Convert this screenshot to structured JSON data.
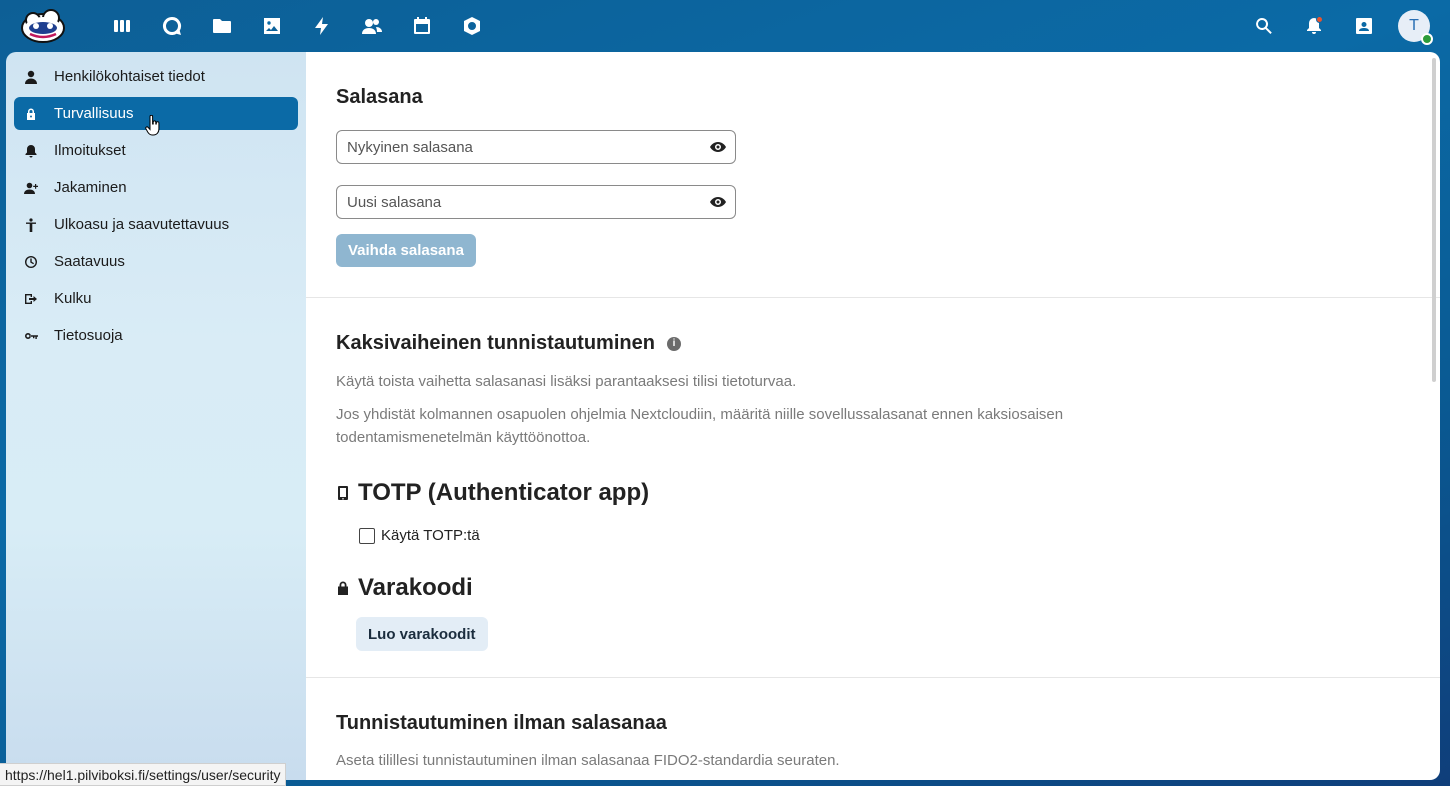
{
  "colors": {
    "accent": "#0b6aa6",
    "disabled_button": "#8fb6d0"
  },
  "header": {
    "apps": [
      "dashboard-icon",
      "search-circle-icon",
      "files-icon",
      "photos-icon",
      "activity-icon",
      "contacts-icon",
      "calendar-icon",
      "settings-box-icon"
    ],
    "avatar_initial": "T"
  },
  "sidebar": {
    "items": [
      {
        "label": "Henkilökohtaiset tiedot",
        "icon": "person-icon"
      },
      {
        "label": "Turvallisuus",
        "icon": "lock-icon",
        "active": true
      },
      {
        "label": "Ilmoitukset",
        "icon": "bell-icon"
      },
      {
        "label": "Jakaminen",
        "icon": "share-person-icon"
      },
      {
        "label": "Ulkoasu ja saavutettavuus",
        "icon": "accessibility-icon"
      },
      {
        "label": "Saatavuus",
        "icon": "clock-icon"
      },
      {
        "label": "Kulku",
        "icon": "migration-icon"
      },
      {
        "label": "Tietosuoja",
        "icon": "key-icon"
      }
    ]
  },
  "password": {
    "title": "Salasana",
    "current_placeholder": "Nykyinen salasana",
    "new_placeholder": "Uusi salasana",
    "change_button": "Vaihda salasana"
  },
  "twofactor": {
    "title": "Kaksivaiheinen tunnistautuminen",
    "hint1": "Käytä toista vaihetta salasanasi lisäksi parantaaksesi tilisi tietoturvaa.",
    "hint2": "Jos yhdistät kolmannen osapuolen ohjelmia Nextcloudiin, määritä niille sovellussalasanat ennen kaksiosaisen todentamismenetelmän käyttöönottoa.",
    "totp_title": "TOTP (Authenticator app)",
    "totp_checkbox": "Käytä TOTP:tä",
    "backup_title": "Varakoodi",
    "backup_button": "Luo varakoodit"
  },
  "passwordless": {
    "title": "Tunnistautuminen ilman salasanaa",
    "hint": "Aseta tilillesi tunnistautuminen ilman salasanaa FIDO2-standardia seuraten."
  },
  "status_url": "https://hel1.pilviboksi.fi/settings/user/security"
}
